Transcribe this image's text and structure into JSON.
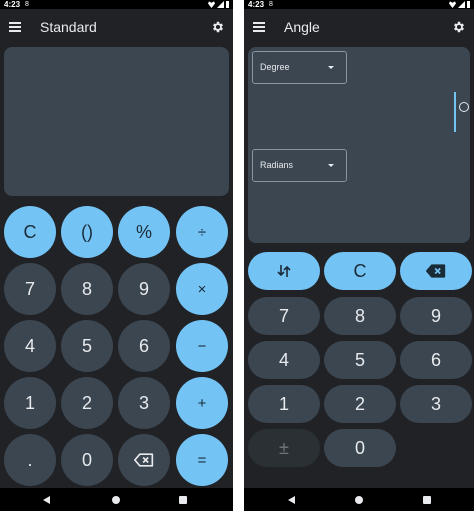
{
  "colors": {
    "background": "#202226",
    "surface": "#3b4651",
    "accent": "#74c3f5",
    "text": "#e8eaed",
    "accent_text": "#1a2b38"
  },
  "left": {
    "status": {
      "time": "4:23",
      "extra": "8"
    },
    "title": "Standard",
    "keys": {
      "clear": "C",
      "parens": "()",
      "percent": "%",
      "divide": "÷",
      "seven": "7",
      "eight": "8",
      "nine": "9",
      "multiply": "×",
      "four": "4",
      "five": "5",
      "six": "6",
      "minus": "−",
      "one": "1",
      "two": "2",
      "three": "3",
      "plus": "+",
      "decimal": ".",
      "zero": "0",
      "backspace_icon": "backspace-icon",
      "equals": "="
    }
  },
  "right": {
    "status": {
      "time": "4:23",
      "extra": "8"
    },
    "title": "Angle",
    "from_unit": "Degree",
    "to_unit": "Radians",
    "input_value": "0",
    "keys": {
      "swap_icon": "swap-arrows-icon",
      "clear": "C",
      "backspace_icon": "backspace-icon",
      "seven": "7",
      "eight": "8",
      "nine": "9",
      "four": "4",
      "five": "5",
      "six": "6",
      "one": "1",
      "two": "2",
      "three": "3",
      "plus_minus": "±",
      "zero": "0"
    }
  }
}
